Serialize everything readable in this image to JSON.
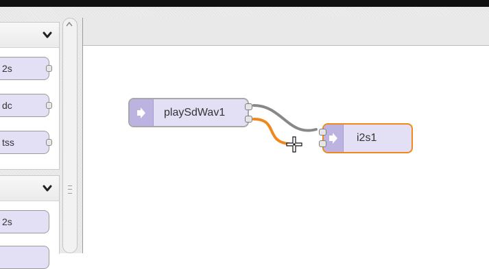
{
  "palette": {
    "sections": [
      {
        "nodes": [
          {
            "label": "2s",
            "has_output": true
          },
          {
            "label": "dc",
            "has_output": true
          },
          {
            "label": "tss",
            "has_output": true
          }
        ]
      },
      {
        "nodes": [
          {
            "label": "2s",
            "has_output": false
          }
        ]
      }
    ],
    "chevron_icon": "chevron-down-icon"
  },
  "flow": {
    "nodes": [
      {
        "id": "playSdWav1",
        "label": "playSdWav1",
        "icon": "arrow-right-icon",
        "selected": false
      },
      {
        "id": "i2s1",
        "label": "i2s1",
        "icon": "arrow-right-icon",
        "selected": true
      }
    ],
    "wires": [
      {
        "from": "playSdWav1.out0",
        "to": "i2s1.in0",
        "color": "#888888",
        "state": "connected"
      },
      {
        "from": "playSdWav1.out1",
        "to": "cursor",
        "color": "#f0861c",
        "state": "dragging"
      }
    ]
  },
  "colors": {
    "node_fill": "#e3dff5",
    "node_icon_fill": "#bdb3e0",
    "selected_border": "#f0861c",
    "wire_gray": "#888888",
    "wire_drag": "#f0861c"
  },
  "cursor": {
    "icon": "move-crosshair-icon"
  }
}
